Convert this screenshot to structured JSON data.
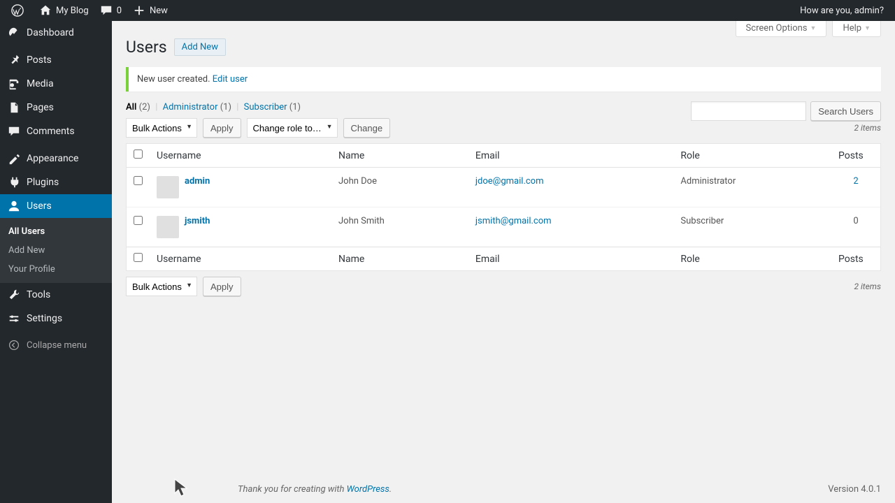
{
  "adminbar": {
    "site_name": "My Blog",
    "comments_count": "0",
    "new_label": "New",
    "greeting": "How are you, admin?"
  },
  "sidebar": {
    "items": [
      {
        "label": "Dashboard",
        "icon": "dashboard"
      },
      {
        "label": "Posts",
        "icon": "pin"
      },
      {
        "label": "Media",
        "icon": "media"
      },
      {
        "label": "Pages",
        "icon": "pages"
      },
      {
        "label": "Comments",
        "icon": "comment"
      },
      {
        "label": "Appearance",
        "icon": "appearance"
      },
      {
        "label": "Plugins",
        "icon": "plugin"
      },
      {
        "label": "Users",
        "icon": "user"
      },
      {
        "label": "Tools",
        "icon": "tools"
      },
      {
        "label": "Settings",
        "icon": "settings"
      }
    ],
    "submenu_users": [
      "All Users",
      "Add New",
      "Your Profile"
    ],
    "collapse_label": "Collapse menu"
  },
  "screen_tabs": {
    "options": "Screen Options",
    "help": "Help"
  },
  "page": {
    "title": "Users",
    "add_new": "Add New",
    "notice_text": "New user created.",
    "notice_link": "Edit user"
  },
  "filters": {
    "all_label": "All",
    "all_count": "(2)",
    "admin_label": "Administrator",
    "admin_count": "(1)",
    "sub_label": "Subscriber",
    "sub_count": "(1)"
  },
  "search": {
    "button": "Search Users"
  },
  "bulk": {
    "actions_label": "Bulk Actions",
    "apply_label": "Apply",
    "change_role_label": "Change role to…",
    "change_label": "Change",
    "items_count": "2 items"
  },
  "table": {
    "headers": {
      "username": "Username",
      "name": "Name",
      "email": "Email",
      "role": "Role",
      "posts": "Posts"
    },
    "rows": [
      {
        "username": "admin",
        "name": "John Doe",
        "email": "jdoe@gmail.com",
        "role": "Administrator",
        "posts": "2",
        "posts_link": true
      },
      {
        "username": "jsmith",
        "name": "John Smith",
        "email": "jsmith@gmail.com",
        "role": "Subscriber",
        "posts": "0",
        "posts_link": false
      }
    ]
  },
  "footer": {
    "thanks_prefix": "Thank you for creating with ",
    "wp_link": "WordPress",
    "suffix": ".",
    "version": "Version 4.0.1"
  }
}
